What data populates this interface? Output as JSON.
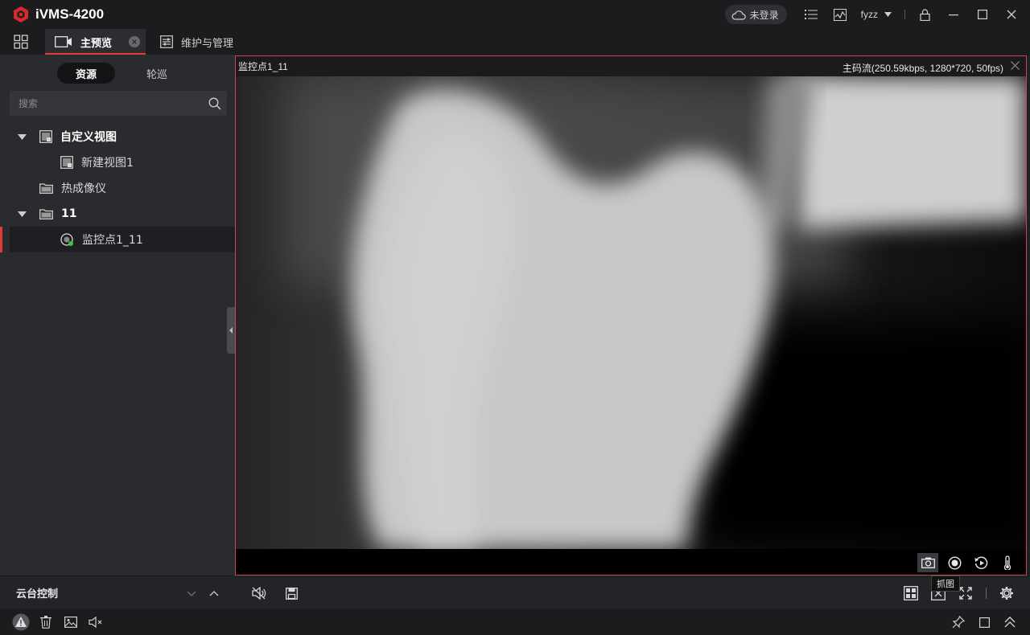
{
  "app": {
    "title": "iVMS-4200"
  },
  "titlebar": {
    "login_label": "未登录",
    "user_name": "fyzz"
  },
  "tabs": [
    {
      "label": "主预览",
      "active": true
    },
    {
      "label": "维护与管理",
      "active": false
    }
  ],
  "sidebar": {
    "segments": [
      "资源",
      "轮巡"
    ],
    "search_placeholder": "搜索",
    "tree": [
      {
        "label": "自定义视图",
        "level": 0,
        "expanded": true,
        "bold": true,
        "icon": "view-icon"
      },
      {
        "label": "新建视图1",
        "level": 1,
        "icon": "view-icon"
      },
      {
        "label": "热成像仪",
        "level": 0,
        "icon": "folder-icon"
      },
      {
        "label": "11",
        "level": 0,
        "expanded": true,
        "bold": true,
        "icon": "folder-icon"
      },
      {
        "label": "监控点1_11",
        "level": 1,
        "selected": true,
        "icon": "camera-online-icon"
      }
    ],
    "ptz_label": "云台控制"
  },
  "video": {
    "camera_name": "监控点1_11",
    "stream_info": "主码流(250.59kbps, 1280*720, 50fps)",
    "tooltip": "抓图"
  },
  "colors": {
    "accent": "#e03a3a",
    "frame_border": "#c74848",
    "background": "#1f1f21",
    "panel": "#2a2b2e"
  }
}
